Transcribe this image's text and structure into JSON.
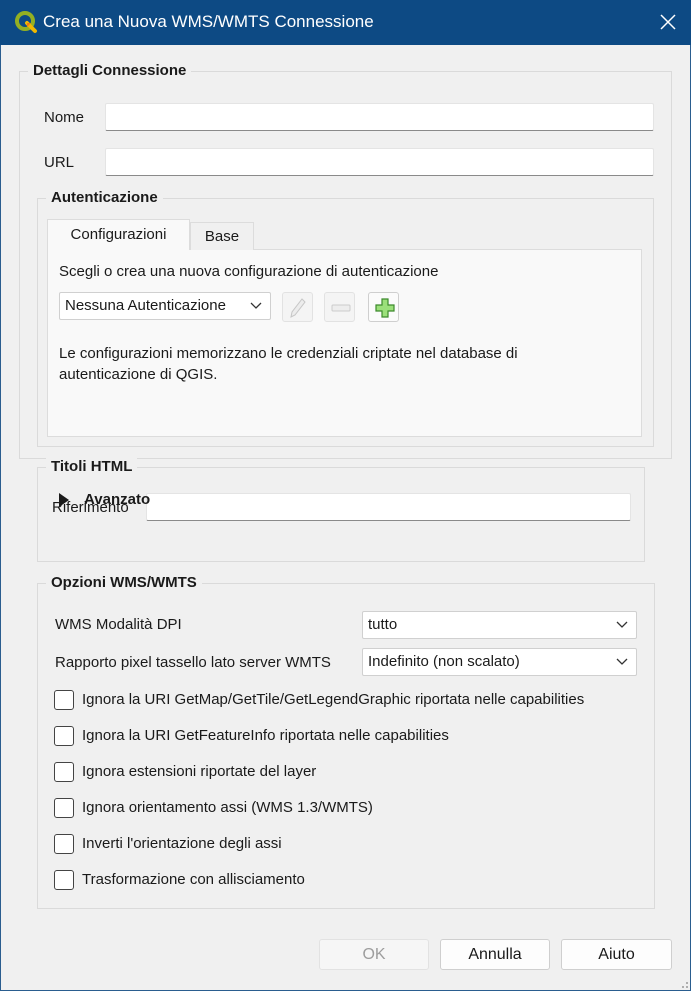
{
  "window": {
    "title": "Crea una Nuova WMS/WMTS Connessione",
    "accent_color": "#0d4a84"
  },
  "connection_details": {
    "group_title": "Dettagli Connessione",
    "name_label": "Nome",
    "name_value": "",
    "url_label": "URL",
    "url_value": ""
  },
  "authentication": {
    "group_title": "Autenticazione",
    "tabs": [
      {
        "label": "Configurazioni",
        "active": true
      },
      {
        "label": "Base",
        "active": false
      }
    ],
    "prompt": "Scegli o crea una nuova configurazione di autenticazione",
    "selected_config": "Nessuna Autenticazione",
    "edit_icon": "pencil-icon",
    "remove_icon": "minus-icon",
    "add_icon": "plus-icon",
    "info_text": "Le configurazioni memorizzano le credenziali criptate nel database di autenticazione di QGIS."
  },
  "html_titles": {
    "group_title": "Titoli HTML",
    "referer_label": "Riferimento",
    "referer_value": "",
    "advanced_label": "Avanzato"
  },
  "wms_options": {
    "group_title": "Opzioni WMS/WMTS",
    "dpi_mode_label": "WMS Modalità DPI",
    "dpi_mode_value": "tutto",
    "tile_ratio_label": "Rapporto pixel tassello lato server WMTS",
    "tile_ratio_value": "Indefinito (non scalato)",
    "checkboxes": [
      {
        "label": "Ignora la URI GetMap/GetTile/GetLegendGraphic riportata nelle capabilities",
        "checked": false
      },
      {
        "label": "Ignora la URI GetFeatureInfo riportata nelle capabilities",
        "checked": false
      },
      {
        "label": "Ignora estensioni riportate del layer",
        "checked": false
      },
      {
        "label": "Ignora orientamento assi (WMS 1.3/WMTS)",
        "checked": false
      },
      {
        "label": "Inverti l'orientazione degli assi",
        "checked": false
      },
      {
        "label": "Trasformazione con allisciamento",
        "checked": false
      }
    ]
  },
  "buttons": {
    "ok": "OK",
    "cancel": "Annulla",
    "help": "Aiuto"
  }
}
